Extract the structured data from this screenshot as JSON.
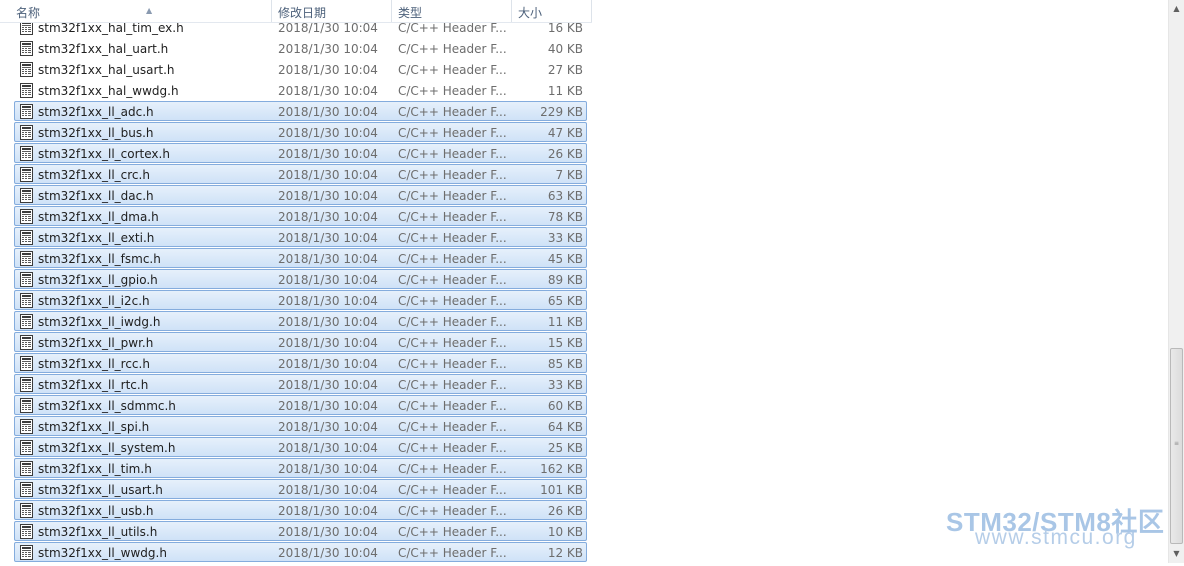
{
  "columns": {
    "name": "名称",
    "date": "修改日期",
    "type": "类型",
    "size": "大小"
  },
  "files": [
    {
      "name": "stm32f1xx_hal_tim_ex.h",
      "date": "2018/1/30 10:04",
      "type": "C/C++ Header F...",
      "size": "16 KB",
      "selected": false
    },
    {
      "name": "stm32f1xx_hal_uart.h",
      "date": "2018/1/30 10:04",
      "type": "C/C++ Header F...",
      "size": "40 KB",
      "selected": false
    },
    {
      "name": "stm32f1xx_hal_usart.h",
      "date": "2018/1/30 10:04",
      "type": "C/C++ Header F...",
      "size": "27 KB",
      "selected": false
    },
    {
      "name": "stm32f1xx_hal_wwdg.h",
      "date": "2018/1/30 10:04",
      "type": "C/C++ Header F...",
      "size": "11 KB",
      "selected": false
    },
    {
      "name": "stm32f1xx_ll_adc.h",
      "date": "2018/1/30 10:04",
      "type": "C/C++ Header F...",
      "size": "229 KB",
      "selected": true
    },
    {
      "name": "stm32f1xx_ll_bus.h",
      "date": "2018/1/30 10:04",
      "type": "C/C++ Header F...",
      "size": "47 KB",
      "selected": true
    },
    {
      "name": "stm32f1xx_ll_cortex.h",
      "date": "2018/1/30 10:04",
      "type": "C/C++ Header F...",
      "size": "26 KB",
      "selected": true
    },
    {
      "name": "stm32f1xx_ll_crc.h",
      "date": "2018/1/30 10:04",
      "type": "C/C++ Header F...",
      "size": "7 KB",
      "selected": true
    },
    {
      "name": "stm32f1xx_ll_dac.h",
      "date": "2018/1/30 10:04",
      "type": "C/C++ Header F...",
      "size": "63 KB",
      "selected": true
    },
    {
      "name": "stm32f1xx_ll_dma.h",
      "date": "2018/1/30 10:04",
      "type": "C/C++ Header F...",
      "size": "78 KB",
      "selected": true
    },
    {
      "name": "stm32f1xx_ll_exti.h",
      "date": "2018/1/30 10:04",
      "type": "C/C++ Header F...",
      "size": "33 KB",
      "selected": true
    },
    {
      "name": "stm32f1xx_ll_fsmc.h",
      "date": "2018/1/30 10:04",
      "type": "C/C++ Header F...",
      "size": "45 KB",
      "selected": true
    },
    {
      "name": "stm32f1xx_ll_gpio.h",
      "date": "2018/1/30 10:04",
      "type": "C/C++ Header F...",
      "size": "89 KB",
      "selected": true
    },
    {
      "name": "stm32f1xx_ll_i2c.h",
      "date": "2018/1/30 10:04",
      "type": "C/C++ Header F...",
      "size": "65 KB",
      "selected": true
    },
    {
      "name": "stm32f1xx_ll_iwdg.h",
      "date": "2018/1/30 10:04",
      "type": "C/C++ Header F...",
      "size": "11 KB",
      "selected": true
    },
    {
      "name": "stm32f1xx_ll_pwr.h",
      "date": "2018/1/30 10:04",
      "type": "C/C++ Header F...",
      "size": "15 KB",
      "selected": true
    },
    {
      "name": "stm32f1xx_ll_rcc.h",
      "date": "2018/1/30 10:04",
      "type": "C/C++ Header F...",
      "size": "85 KB",
      "selected": true
    },
    {
      "name": "stm32f1xx_ll_rtc.h",
      "date": "2018/1/30 10:04",
      "type": "C/C++ Header F...",
      "size": "33 KB",
      "selected": true
    },
    {
      "name": "stm32f1xx_ll_sdmmc.h",
      "date": "2018/1/30 10:04",
      "type": "C/C++ Header F...",
      "size": "60 KB",
      "selected": true
    },
    {
      "name": "stm32f1xx_ll_spi.h",
      "date": "2018/1/30 10:04",
      "type": "C/C++ Header F...",
      "size": "64 KB",
      "selected": true
    },
    {
      "name": "stm32f1xx_ll_system.h",
      "date": "2018/1/30 10:04",
      "type": "C/C++ Header F...",
      "size": "25 KB",
      "selected": true
    },
    {
      "name": "stm32f1xx_ll_tim.h",
      "date": "2018/1/30 10:04",
      "type": "C/C++ Header F...",
      "size": "162 KB",
      "selected": true
    },
    {
      "name": "stm32f1xx_ll_usart.h",
      "date": "2018/1/30 10:04",
      "type": "C/C++ Header F...",
      "size": "101 KB",
      "selected": true
    },
    {
      "name": "stm32f1xx_ll_usb.h",
      "date": "2018/1/30 10:04",
      "type": "C/C++ Header F...",
      "size": "26 KB",
      "selected": true
    },
    {
      "name": "stm32f1xx_ll_utils.h",
      "date": "2018/1/30 10:04",
      "type": "C/C++ Header F...",
      "size": "10 KB",
      "selected": true
    },
    {
      "name": "stm32f1xx_ll_wwdg.h",
      "date": "2018/1/30 10:04",
      "type": "C/C++ Header F...",
      "size": "12 KB",
      "selected": true
    }
  ],
  "watermark": {
    "line1": "STM32/STM8社区",
    "line2": "www.stmcu.org"
  },
  "icons": {
    "file": "header-file-icon",
    "sort": "sort-ascending-icon"
  },
  "colors": {
    "selection_bg": "#d9e8f9",
    "selection_border": "#84acdd",
    "header_text": "#4c607a",
    "watermark": "#a9c6e6"
  }
}
